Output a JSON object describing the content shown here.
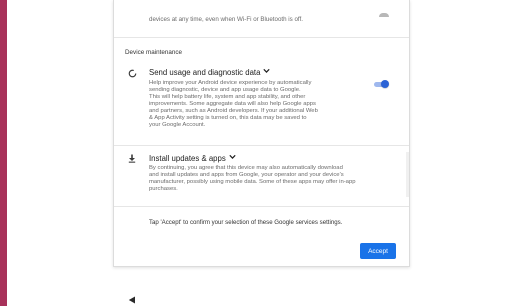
{
  "colors": {
    "accent_bar": "#a8325a",
    "primary": "#1a73e8",
    "toggle_on": "#2b63d6"
  },
  "top": {
    "text": "devices at any time, even when Wi-Fi or Bluetooth is off."
  },
  "section": {
    "header": "Device maintenance"
  },
  "items": [
    {
      "icon": "diagnostic-circle-icon",
      "title": "Send usage and diagnostic data",
      "description_lines": [
        "Help improve your Android device experience by automatically",
        "sending diagnostic, device and app usage data to Google.",
        "This will help battery life, system and app stability, and other",
        "improvements. Some aggregate data will also help Google apps",
        "and partners, such as Android developers. If your additional Web",
        "& App Activity setting is turned on, this data may be saved to",
        "your Google Account."
      ],
      "toggle_on": true
    },
    {
      "icon": "download-icon",
      "title": "Install updates & apps",
      "description_lines": [
        "By continuing, you agree that this device may also automatically download",
        "and install updates and apps from Google, your operator and your device's",
        "manufacturer, possibly using mobile data. Some of these apps may offer in-app",
        "purchases."
      ]
    }
  ],
  "confirm": {
    "text": "Tap 'Accept' to confirm your selection of these Google services settings."
  },
  "accept_button": {
    "label": "Accept"
  },
  "nav": {
    "back_icon": "back-triangle-icon"
  }
}
